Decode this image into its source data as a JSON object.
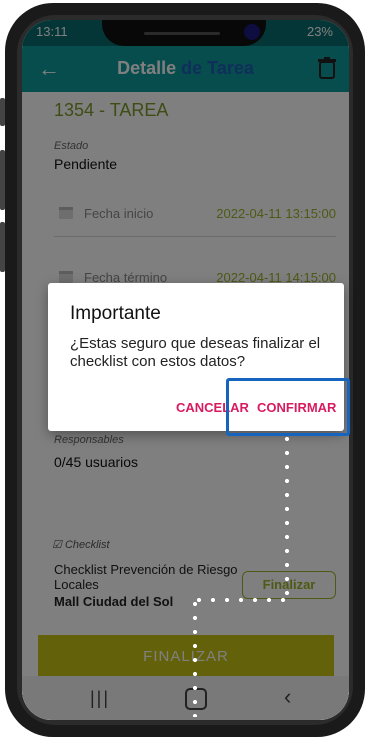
{
  "status_bar": {
    "time": "13:11",
    "right": "23%"
  },
  "app_bar": {
    "title_part1": "Detalle",
    "title_part2": "de Tarea"
  },
  "task": {
    "id": "1354 - TAREA",
    "estado_label": "Estado",
    "estado_value": "Pendiente",
    "fecha_inicio_label": "Fecha inicio",
    "fecha_inicio_value": "2022-04-11 13:15:00",
    "fecha_termino_label": "Fecha término",
    "fecha_termino_value": "2022-04-11 14:15:00",
    "responsables_label": "Responsables",
    "responsables_value": "0/45 usuarios"
  },
  "checklist": {
    "header": "Checklist",
    "item_name": "Checklist Prevención de Riesgo Locales",
    "item_place": "Mall Ciudad del Sol",
    "item_button": "Finalizar"
  },
  "main_button": "FINALIZAR",
  "dialog": {
    "title": "Importante",
    "message": "¿Estas seguro que deseas finalizar el checklist con estos datos?",
    "cancel": "CANCELAR",
    "confirm": "CONFIRMAR"
  },
  "colors": {
    "primary": "#0f9a9c",
    "accent": "#1f5fb5",
    "date": "#9bb52a",
    "finalize": "#c7c414",
    "dialog_button": "#d81b60",
    "highlight": "#1565c0"
  }
}
